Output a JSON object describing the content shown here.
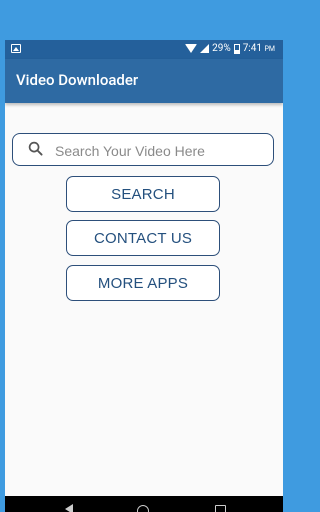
{
  "status_bar": {
    "battery": "29%",
    "time": "7:41",
    "ampm": "PM"
  },
  "app_bar": {
    "title": "Video Downloader"
  },
  "search": {
    "placeholder": "Search Your Video Here",
    "value": ""
  },
  "buttons": {
    "search_label": "SEARCH",
    "contact_label": "CONTACT US",
    "more_apps_label": "MORE APPS"
  },
  "colors": {
    "primary": "#2e6aa3",
    "status": "#24609b",
    "accent_text": "#24507e",
    "outline": "#2d4f7a"
  }
}
